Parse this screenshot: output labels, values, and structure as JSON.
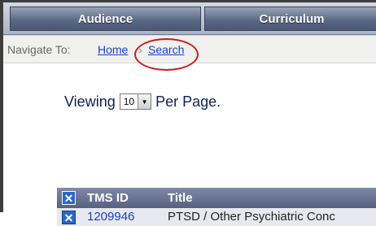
{
  "nav": {
    "tabs": [
      {
        "label": "Audience"
      },
      {
        "label": "Curriculum"
      }
    ]
  },
  "breadcrumb": {
    "label": "Navigate To:",
    "items": [
      {
        "label": "Home"
      },
      {
        "label": "Search"
      }
    ],
    "separator": "›",
    "highlight_color": "#c41e1e"
  },
  "paging": {
    "prefix": "Viewing",
    "value": "10",
    "suffix": "Per Page."
  },
  "table": {
    "columns": [
      "TMS ID",
      "Title"
    ],
    "rows": [
      {
        "id": "1209946",
        "title": "PTSD / Other Psychiatric Conc"
      }
    ]
  },
  "colors": {
    "nav_tab": "#5d6a86",
    "link": "#1a3ec2",
    "header_bg": "#56617f",
    "checkbox": "#2c66c8"
  }
}
